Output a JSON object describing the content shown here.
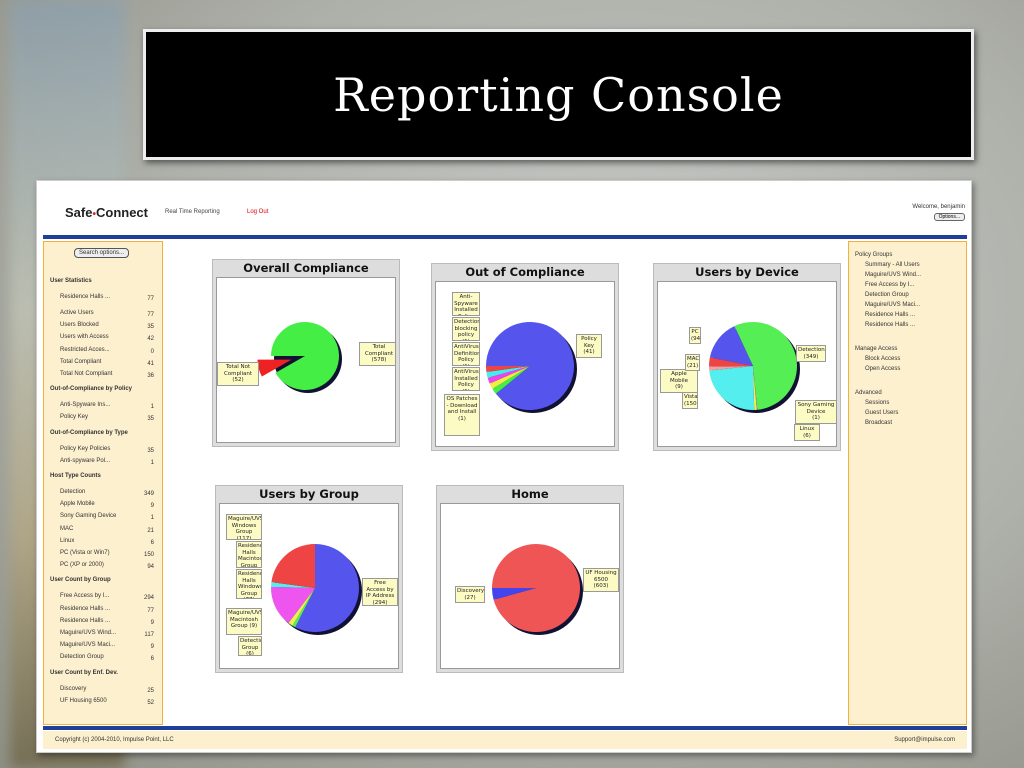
{
  "slide": {
    "title": "Reporting Console"
  },
  "header": {
    "logo_left": "Safe",
    "logo_dot": "•",
    "logo_right": "Connect",
    "real_time": "Real Time Reporting",
    "logout": "Log Out",
    "welcome": "Welcome, benjamin",
    "options": "Options..."
  },
  "left": {
    "search": "Search options...",
    "sections": [
      {
        "title": "User Statistics",
        "items": [
          [
            "Residence Halls ...",
            "77"
          ],
          [
            "Active Users",
            "77"
          ],
          [
            "Users Blocked",
            "35"
          ],
          [
            "Users with Access",
            "42"
          ],
          [
            "Restricted Acces...",
            "0"
          ],
          [
            "Total Compliant",
            "41"
          ],
          [
            "Total Not Compliant",
            "36"
          ]
        ]
      },
      {
        "title": "Out-of-Compliance by Policy",
        "items": [
          [
            "Anti-Spyware Ins...",
            "1"
          ],
          [
            "Policy Key",
            "35"
          ]
        ]
      },
      {
        "title": "Out-of-Compliance by Type",
        "items": [
          [
            "Policy Key Policies",
            "35"
          ],
          [
            "Anti-spyware Pol...",
            "1"
          ]
        ]
      },
      {
        "title": "Host Type Counts",
        "items": [
          [
            "Detection",
            "349"
          ],
          [
            "Apple Mobile",
            "9"
          ],
          [
            "Sony Gaming Device",
            "1"
          ],
          [
            "MAC",
            "21"
          ],
          [
            "Linux",
            "6"
          ],
          [
            "PC (Vista or Win7)",
            "150"
          ],
          [
            "PC (XP or 2000)",
            "94"
          ]
        ]
      },
      {
        "title": "User Count by Group",
        "items": [
          [
            "Free Access by I...",
            "294"
          ],
          [
            "Residence Halls ...",
            "77"
          ],
          [
            "Residence Halls ...",
            "9"
          ],
          [
            "Maguire/UVS Wind...",
            "117"
          ],
          [
            "Maguire/UVS Maci...",
            "9"
          ],
          [
            "Detection Group",
            "6"
          ]
        ]
      },
      {
        "title": "User Count by Enf. Dev.",
        "items": [
          [
            "Discovery",
            "25"
          ],
          [
            "UF Housing 6500",
            "52"
          ]
        ]
      }
    ]
  },
  "right": {
    "sections": [
      {
        "title": "Policy Groups",
        "items": [
          "Summary - All Users",
          "Maguire/UVS Wind...",
          "Free Access by I...",
          "Detection Group",
          "Maguire/UVS Maci...",
          "Residence Halls ...",
          "Residence Halls ..."
        ]
      },
      {
        "title": "Manage Access",
        "items": [
          "Block Access",
          "Open Access"
        ]
      },
      {
        "title": "Advanced",
        "items": [
          "Sessions",
          "Guest Users",
          "Broadcast"
        ]
      }
    ]
  },
  "footer": {
    "copyright": "Copyright (c) 2004-2010, Impulse Point, LLC",
    "support": "Support@impulse.com"
  },
  "chart_data": [
    {
      "type": "pie",
      "title": "Overall Compliance",
      "slices": [
        {
          "label": "Total Compliant",
          "value": 578,
          "color": "#44ee44"
        },
        {
          "label": "Total Not Compliant",
          "value": 52,
          "color": "#ee2222"
        }
      ]
    },
    {
      "type": "pie",
      "title": "Out of Compliance",
      "slices": [
        {
          "label": "Policy Key",
          "value": 41,
          "color": "#5555ee"
        },
        {
          "label": "OS Patches - Download and Install",
          "value": 1,
          "color": "#44ee44"
        },
        {
          "label": "AntiVirus Installed Policy",
          "value": 1,
          "color": "#eeee44"
        },
        {
          "label": "AntiVirus Definition Policy",
          "value": 1,
          "color": "#ee44ee"
        },
        {
          "label": "Detection blocking policy",
          "value": 1,
          "color": "#44eeee"
        },
        {
          "label": "Anti-Spyware Installed Policy",
          "value": 1,
          "color": "#ee4444"
        }
      ]
    },
    {
      "type": "pie",
      "title": "Users by Device",
      "slices": [
        {
          "label": "Detection",
          "value": 349,
          "color": "#55ee55"
        },
        {
          "label": "Sony Gaming Device",
          "value": 1,
          "color": "#ee55ee"
        },
        {
          "label": "Linux",
          "value": 6,
          "color": "#eeee55"
        },
        {
          "label": "Vista",
          "value": 150,
          "color": "#55eeee"
        },
        {
          "label": "Apple Mobile",
          "value": 9,
          "color": "#f0a0a0"
        },
        {
          "label": "MAC",
          "value": 21,
          "color": "#ee4444"
        },
        {
          "label": "PC",
          "value": 94,
          "color": "#5555ee"
        }
      ]
    },
    {
      "type": "pie",
      "title": "Users by Group",
      "slices": [
        {
          "label": "Free Access by IP Address",
          "value": 294,
          "color": "#5555ee"
        },
        {
          "label": "Detection Group",
          "value": 6,
          "color": "#55ee55"
        },
        {
          "label": "Maguire/UVS Macintosh Group",
          "value": 9,
          "color": "#eeee55"
        },
        {
          "label": "Residence Halls Windows Group",
          "value": 77,
          "color": "#ee55ee"
        },
        {
          "label": "Residence Halls Macintosh Group",
          "value": 9,
          "color": "#55eeee"
        },
        {
          "label": "Maguire/UVS Windows Group",
          "value": 117,
          "color": "#ee4444"
        }
      ]
    },
    {
      "type": "pie",
      "title": "Home",
      "slices": [
        {
          "label": "UF Housing 6500",
          "value": 603,
          "color": "#f05555"
        },
        {
          "label": "Discovery",
          "value": 27,
          "color": "#4444ee"
        }
      ]
    }
  ]
}
